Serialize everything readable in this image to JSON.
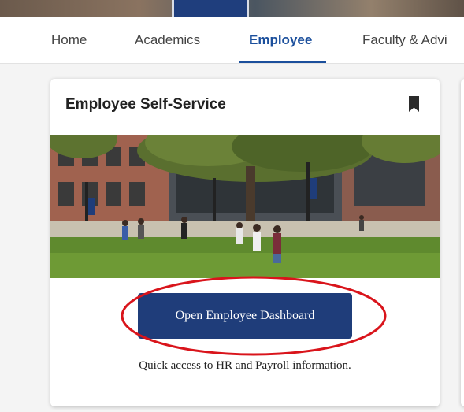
{
  "nav": {
    "tabs": [
      {
        "label": "Home",
        "active": false
      },
      {
        "label": "Academics",
        "active": false
      },
      {
        "label": "Employee",
        "active": true
      },
      {
        "label": "Faculty & Advi",
        "active": false
      }
    ]
  },
  "card": {
    "title": "Employee Self-Service",
    "bookmark_icon": "bookmark-icon",
    "button_label": "Open Employee Dashboard",
    "caption": "Quick access to HR and Payroll information."
  },
  "colors": {
    "accent": "#1b4f9c",
    "button_bg": "#1f3d7a",
    "annotation": "#d9141b"
  }
}
